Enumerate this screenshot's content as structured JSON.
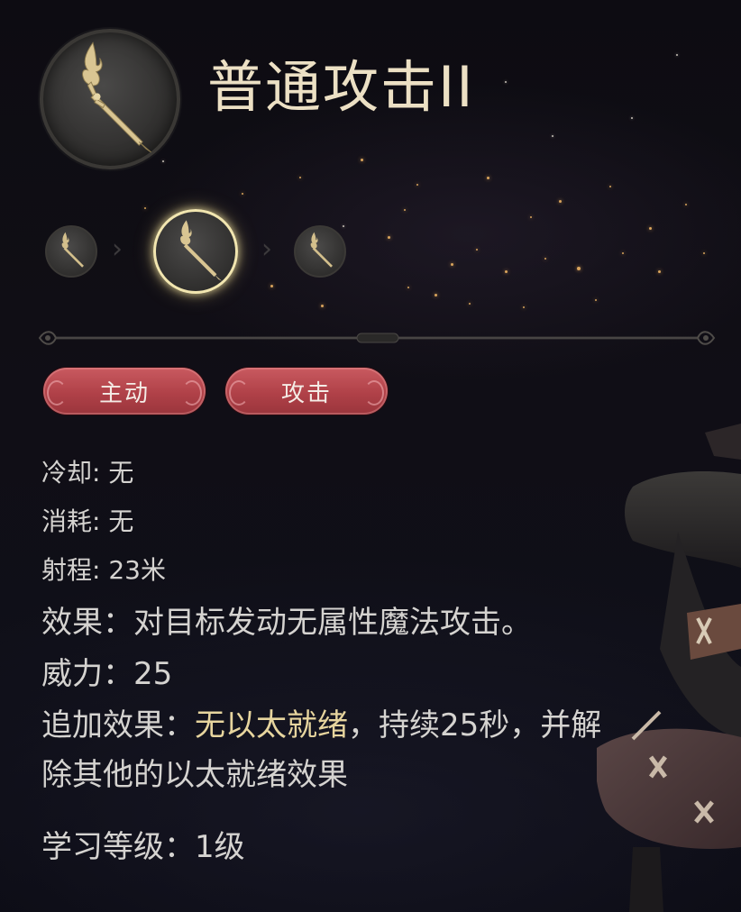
{
  "skill": {
    "title": "普通攻击II",
    "icon": "flame-wand-icon"
  },
  "progression": [
    {
      "icon": "flame-wand-icon",
      "active": false
    },
    {
      "icon": "flame-wand-icon",
      "active": true
    },
    {
      "icon": "flame-wand-icon",
      "active": false
    }
  ],
  "tags": [
    "主动",
    "攻击"
  ],
  "stats": {
    "cooldown": "冷却: 无",
    "cost": "消耗: 无",
    "range": "射程: 23米"
  },
  "effect": "效果：对目标发动无属性魔法攻击。",
  "potency": "威力：25",
  "additional": {
    "prefix": "追加效果：",
    "highlight": "无以太就绪",
    "suffix": "，持续25秒，并解",
    "line2": "除其他的以太就绪效果"
  },
  "learn_level": "学习等级：1级",
  "colors": {
    "title": "#ece0c4",
    "tag_bg": "#b04148",
    "highlight": "#e7d59e",
    "text": "#d5d3d0"
  }
}
